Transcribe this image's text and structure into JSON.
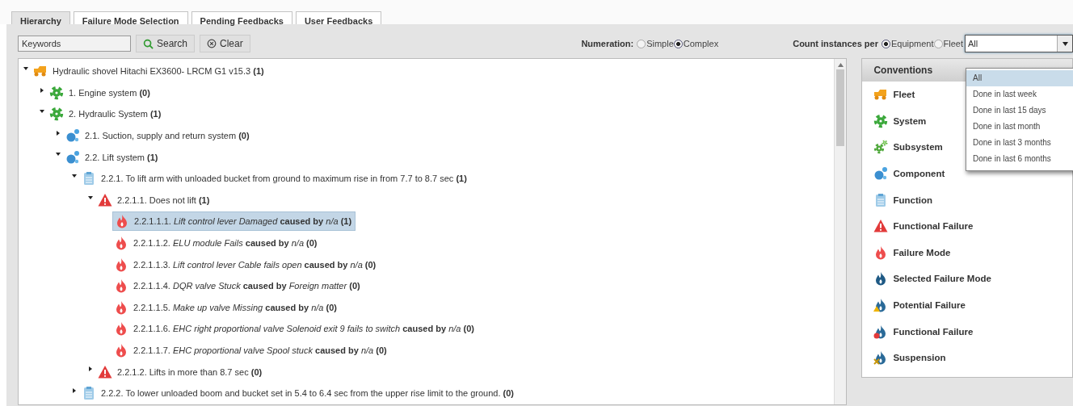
{
  "tabs": [
    {
      "label": "Hierarchy",
      "selected": true
    },
    {
      "label": "Failure Mode Selection",
      "selected": false
    },
    {
      "label": "Pending Feedbacks",
      "selected": false
    },
    {
      "label": "User Feedbacks",
      "selected": false
    }
  ],
  "toolbar": {
    "search_field": {
      "placeholder": "Keywords"
    },
    "search_button": "Search",
    "clear_button": "Clear",
    "numeration": {
      "label": "Numeration:",
      "options": [
        {
          "label": "Simple",
          "selected": false
        },
        {
          "label": "Complex",
          "selected": true
        }
      ]
    },
    "count_instances": {
      "label": "Count instances per",
      "options": [
        {
          "label": "Equipment",
          "selected": true
        },
        {
          "label": "Fleet",
          "selected": false
        }
      ]
    },
    "period_select": {
      "value": "All",
      "menu": [
        {
          "label": "All",
          "selected": true
        },
        {
          "label": "Done in last week",
          "selected": false
        },
        {
          "label": "Done in last 15 days",
          "selected": false
        },
        {
          "label": "Done in last month",
          "selected": false
        },
        {
          "label": "Done in last 3 months",
          "selected": false
        },
        {
          "label": "Done in last 6 months",
          "selected": false
        }
      ]
    }
  },
  "tree": {
    "nodes": [
      {
        "kind": "fleet",
        "text": "Hydraulic shovel Hitachi EX3600- LRCM G1 v15.3 **(1)**",
        "expanded": true,
        "selected": false,
        "children": [
          {
            "kind": "system",
            "text": "1. Engine system **(0)**",
            "expanded": false,
            "selected": false
          },
          {
            "kind": "system",
            "text": "2. Hydraulic System **(1)**",
            "expanded": true,
            "selected": false,
            "children": [
              {
                "kind": "component",
                "text": "2.1. Suction, supply and return system **(0)**",
                "expanded": false,
                "selected": false
              },
              {
                "kind": "component",
                "text": "2.2. Lift system **(1)**",
                "expanded": true,
                "selected": false,
                "children": [
                  {
                    "kind": "function",
                    "text": "2.2.1. To lift arm with unloaded bucket from ground to maximum rise in from 7.7 to 8.7 sec **(1)**",
                    "expanded": true,
                    "selected": false,
                    "children": [
                      {
                        "kind": "functional-failure",
                        "text": "2.2.1.1. Does not lift **(1)**",
                        "expanded": true,
                        "selected": false,
                        "children": [
                          {
                            "kind": "failure-mode",
                            "text": "2.2.1.1.1. *Lift control lever Damaged* **caused by** *n/a* **(1)**",
                            "selected": true
                          },
                          {
                            "kind": "failure-mode",
                            "text": "2.2.1.1.2. *ELU module Fails* **caused by** *n/a* **(0)**",
                            "selected": false
                          },
                          {
                            "kind": "failure-mode",
                            "text": "2.2.1.1.3. *Lift control lever Cable fails open* **caused by** *n/a* **(0)**",
                            "selected": false
                          },
                          {
                            "kind": "failure-mode",
                            "text": "2.2.1.1.4. *DQR valve Stuck* **caused by** *Foreign matter* **(0)**",
                            "selected": false
                          },
                          {
                            "kind": "failure-mode",
                            "text": "2.2.1.1.5. *Make up valve Missing* **caused by** *n/a* **(0)**",
                            "selected": false
                          },
                          {
                            "kind": "failure-mode",
                            "text": "2.2.1.1.6. *EHC right proportional valve Solenoid exit 9 fails to switch* **caused by** *n/a* **(0)**",
                            "selected": false
                          },
                          {
                            "kind": "failure-mode",
                            "text": "2.2.1.1.7. *EHC proportional valve Spool stuck* **caused by** *n/a* **(0)**",
                            "selected": false
                          }
                        ]
                      },
                      {
                        "kind": "functional-failure",
                        "text": "2.2.1.2. Lifts in more than 8.7 sec **(0)**",
                        "expanded": false,
                        "selected": false
                      }
                    ]
                  },
                  {
                    "kind": "function",
                    "text": "2.2.2. To lower unloaded boom and bucket set in 5.4 to 6.4 sec from the upper rise limit to the ground. **(0)**",
                    "expanded": false,
                    "selected": false
                  }
                ]
              }
            ]
          }
        ]
      }
    ]
  },
  "conventions": {
    "title": "Conventions",
    "items": [
      {
        "kind": "fleet",
        "label": "Fleet"
      },
      {
        "kind": "system",
        "label": "System"
      },
      {
        "kind": "subsystem",
        "label": "Subsystem"
      },
      {
        "kind": "component",
        "label": "Component"
      },
      {
        "kind": "function",
        "label": "Function"
      },
      {
        "kind": "functional-failure",
        "label": "Functional Failure"
      },
      {
        "kind": "failure-mode",
        "label": "Failure Mode"
      },
      {
        "kind": "selected-failure-mode",
        "label": "Selected Failure Mode"
      },
      {
        "kind": "potential-failure",
        "label": "Potential Failure"
      },
      {
        "kind": "flame-failure",
        "label": "Functional Failure"
      },
      {
        "kind": "suspension",
        "label": "Suspension"
      }
    ]
  }
}
